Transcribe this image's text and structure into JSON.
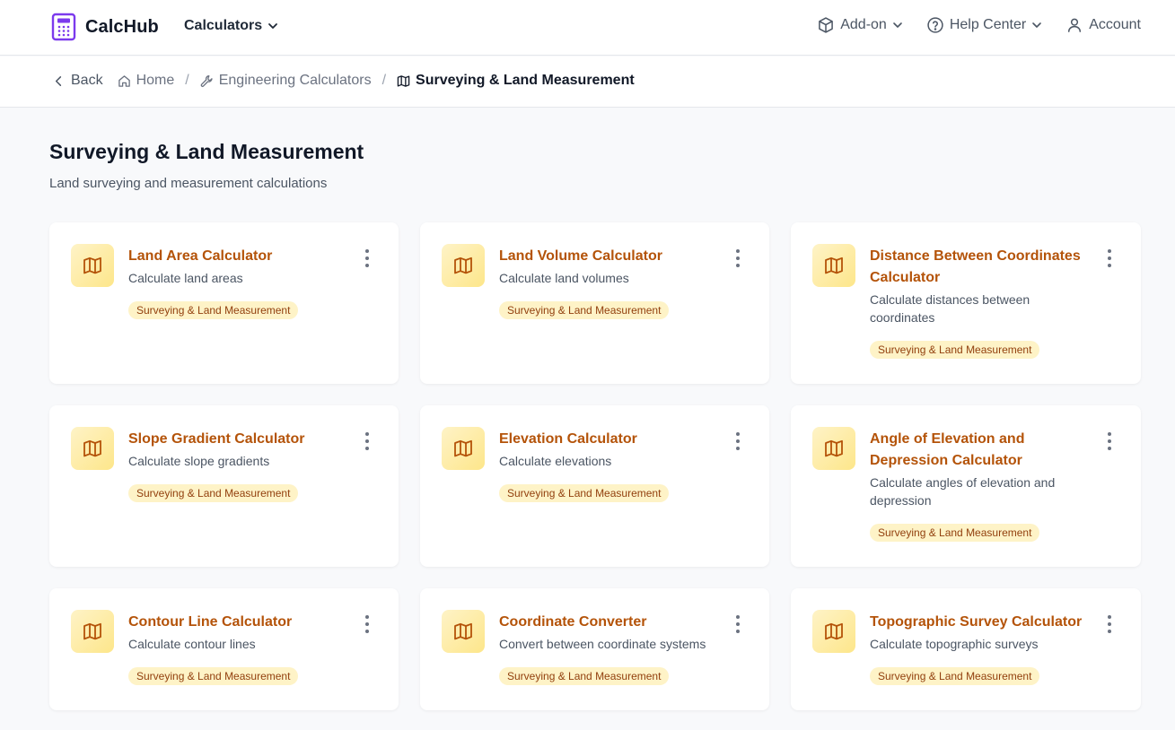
{
  "header": {
    "logo_text": "CalcHub",
    "calculators_label": "Calculators",
    "addon_label": "Add-on",
    "help_label": "Help Center",
    "account_label": "Account",
    "accent": "#7c3aed"
  },
  "breadcrumb": {
    "back": "Back",
    "home": "Home",
    "engineering": "Engineering Calculators",
    "current": "Surveying & Land Measurement"
  },
  "page": {
    "title": "Surveying & Land Measurement",
    "subtitle": "Land surveying and measurement calculations"
  },
  "cards": [
    {
      "title": "Land Area Calculator",
      "desc": "Calculate land areas",
      "badge": "Surveying & Land Measurement",
      "icon": "map-icon"
    },
    {
      "title": "Land Volume Calculator",
      "desc": "Calculate land volumes",
      "badge": "Surveying & Land Measurement",
      "icon": "map-icon"
    },
    {
      "title": "Distance Between Coordinates Calculator",
      "desc": "Calculate distances between coordinates",
      "badge": "Surveying & Land Measurement",
      "icon": "map-icon"
    },
    {
      "title": "Slope Gradient Calculator",
      "desc": "Calculate slope gradients",
      "badge": "Surveying & Land Measurement",
      "icon": "map-icon"
    },
    {
      "title": "Elevation Calculator",
      "desc": "Calculate elevations",
      "badge": "Surveying & Land Measurement",
      "icon": "map-icon"
    },
    {
      "title": "Angle of Elevation and Depression Calculator",
      "desc": "Calculate angles of elevation and depression",
      "badge": "Surveying & Land Measurement",
      "icon": "map-icon"
    },
    {
      "title": "Contour Line Calculator",
      "desc": "Calculate contour lines",
      "badge": "Surveying & Land Measurement",
      "icon": "map-icon"
    },
    {
      "title": "Coordinate Converter",
      "desc": "Convert between coordinate systems",
      "badge": "Surveying & Land Measurement",
      "icon": "map-icon"
    },
    {
      "title": "Topographic Survey Calculator",
      "desc": "Calculate topographic surveys",
      "badge": "Surveying & Land Measurement",
      "icon": "map-icon"
    }
  ],
  "colors": {
    "card_title": "#b45309",
    "badge_bg": "#fef3c7",
    "badge_text": "#92400e"
  }
}
